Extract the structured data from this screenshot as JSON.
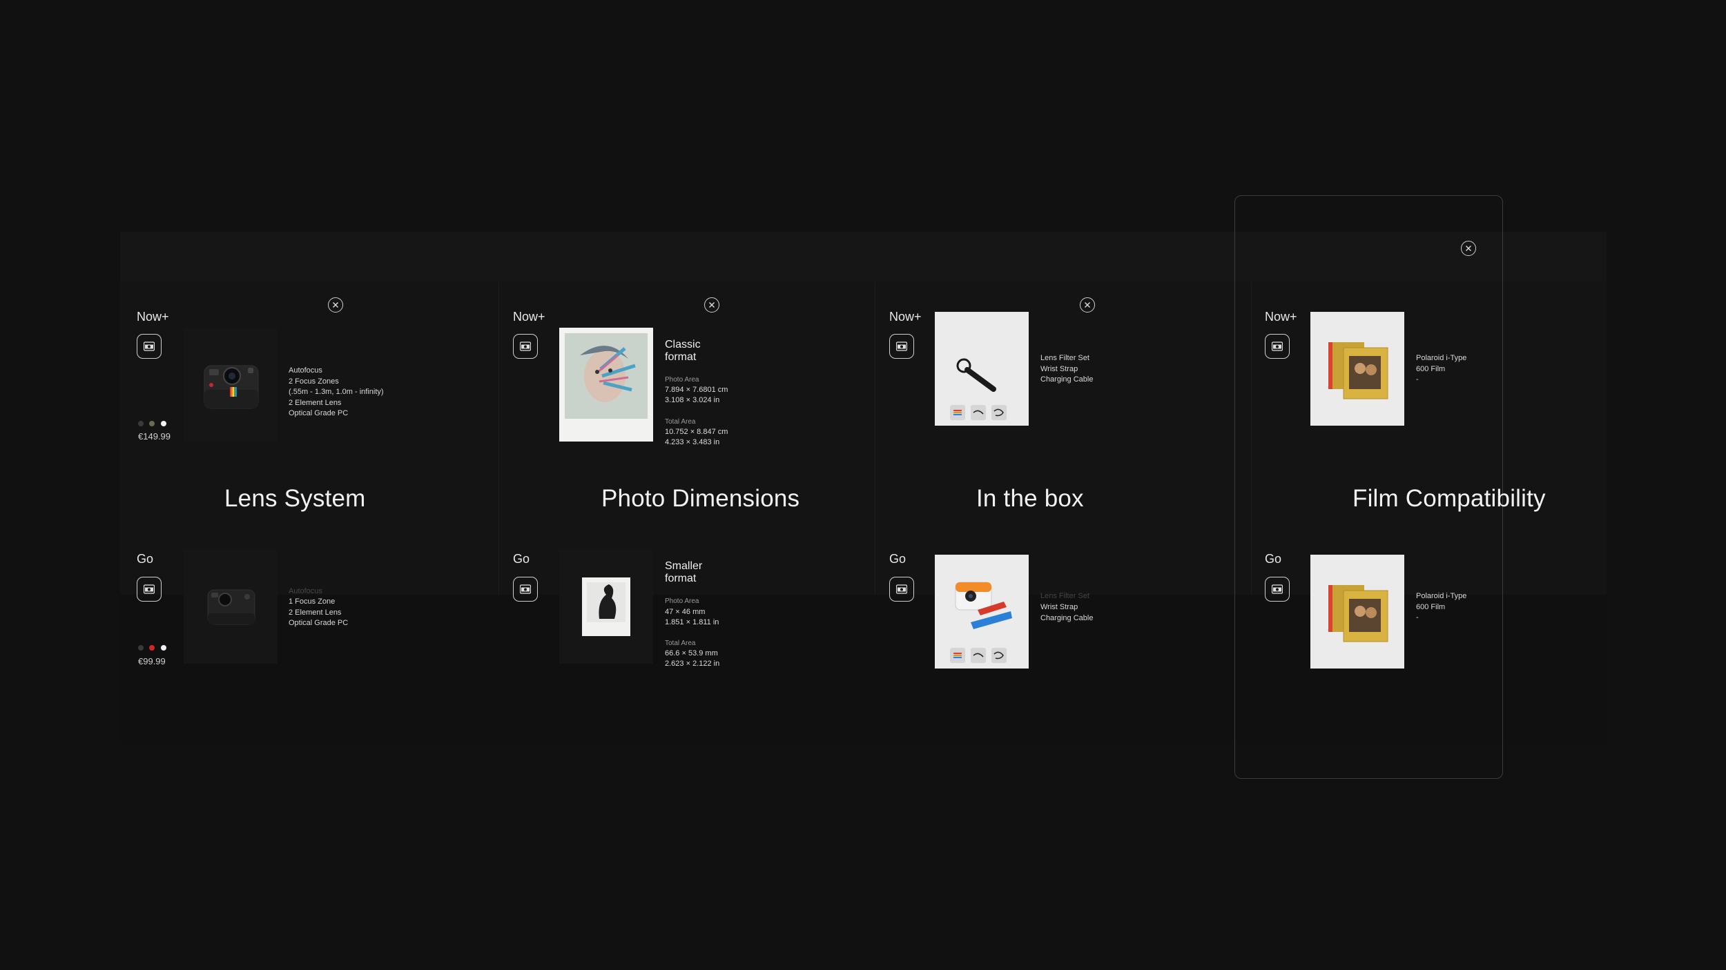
{
  "columns": [
    {
      "title": "Lens System",
      "top": {
        "model": "Now+",
        "specs": [
          "Autofocus",
          "2 Focus Zones",
          "(.55m - 1.3m, 1.0m - infinity)",
          "2 Element Lens",
          "Optical Grade PC"
        ],
        "price": "€149.99",
        "swatches": [
          "#3a3a3a",
          "#6b6b52",
          "#f2f2f2"
        ]
      },
      "bottom": {
        "model": "Go",
        "specs_faded": "Autofocus",
        "specs": [
          "1 Focus Zone",
          "2 Element Lens",
          "Optical Grade PC"
        ],
        "price": "€99.99",
        "swatches": [
          "#3a3a3a",
          "#d32626",
          "#f2f2f2"
        ]
      }
    },
    {
      "title": "Photo Dimensions",
      "top": {
        "model": "Now+",
        "format": "Classic format",
        "photo_area_label": "Photo Area",
        "photo_area": [
          "7.894 × 7.6801 cm",
          "3.108 × 3.024 in"
        ],
        "total_area_label": "Total Area",
        "total_area": [
          "10.752 × 8.847 cm",
          "4.233 × 3.483 in"
        ]
      },
      "bottom": {
        "model": "Go",
        "format": "Smaller format",
        "photo_area_label": "Photo Area",
        "photo_area": [
          "47 × 46 mm",
          "1.851 × 1.811 in"
        ],
        "total_area_label": "Total Area",
        "total_area": [
          "66.6 × 53.9 mm",
          "2.623 × 2.122 in"
        ]
      }
    },
    {
      "title": "In the box",
      "top": {
        "model": "Now+",
        "items": [
          "Lens Filter Set",
          "Wrist Strap",
          "Charging Cable"
        ]
      },
      "bottom": {
        "model": "Go",
        "items_faded": "Lens Filter Set",
        "items": [
          "Wrist Strap",
          "Charging Cable"
        ]
      }
    },
    {
      "title": "Film Compatibility",
      "top": {
        "model": "Now+",
        "films": [
          "Polaroid i-Type",
          "600 Film",
          "-"
        ]
      },
      "bottom": {
        "model": "Go",
        "films": [
          "Polaroid i-Type",
          "600 Film",
          "-"
        ]
      }
    }
  ],
  "icons": {
    "close": "close-icon",
    "camera": "camera-icon"
  },
  "colors": {
    "background": "#111111",
    "panel": "#141414",
    "product_image_bg": "#ebebeb"
  }
}
